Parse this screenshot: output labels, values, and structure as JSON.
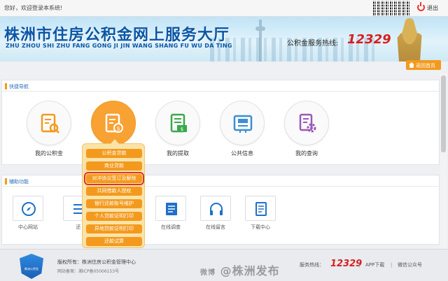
{
  "topbar": {
    "greeting": "您好，欢迎登录本系统!",
    "exit_label": "退出"
  },
  "banner": {
    "title": "株洲市住房公积金网上服务大厅",
    "pinyin": "ZHU ZHOU SHI ZHU FANG GONG JI JIN WANG SHANG FU WU DA TING",
    "hotline_label": "公积金服务热线:",
    "hotline_number": "12329"
  },
  "home_button": {
    "label": "返回首页"
  },
  "quick_nav": {
    "title": "快捷导航",
    "items": [
      {
        "label": "我的公积金",
        "icon": "document-search-icon"
      },
      {
        "label": "",
        "icon": "money-document-icon"
      },
      {
        "label": "我的提取",
        "icon": "withdraw-document-icon"
      },
      {
        "label": "公共信息",
        "icon": "public-info-icon"
      },
      {
        "label": "我的查询",
        "icon": "query-settings-icon"
      }
    ],
    "dropdown": [
      "公积金贷款",
      "商业贷款",
      "对冲协议签订及解除",
      "共同借款人授权",
      "银行还款账号维护",
      "个人贷款证明打印",
      "异地贷款证明打印",
      "还款试算"
    ],
    "selected_index": 2
  },
  "assist": {
    "title": "辅助功能",
    "tools": [
      {
        "label": "中心网站",
        "icon": "compass-icon"
      },
      {
        "label": "还",
        "icon": "list-icon"
      },
      {
        "label": "在线调查",
        "icon": "survey-icon"
      },
      {
        "label": "在线留言",
        "icon": "headset-icon"
      },
      {
        "label": "下载中心",
        "icon": "download-doc-icon"
      }
    ]
  },
  "footer": {
    "emblem_text": "株洲公积金",
    "copyright": "版权所有：株洲住房公积金管理中心",
    "icp": "网站备案：湘ICP备05006153号",
    "service_label": "服务热线：",
    "service_number": "12329",
    "app_label": "APP下载",
    "wechat_label": "微信公众号"
  },
  "watermark": {
    "prefix": "微博",
    "text": "@株洲发布"
  },
  "colors": {
    "accent": "#f39a1e",
    "brand_blue": "#0b56a6",
    "hotline_red": "#d81e1e"
  }
}
